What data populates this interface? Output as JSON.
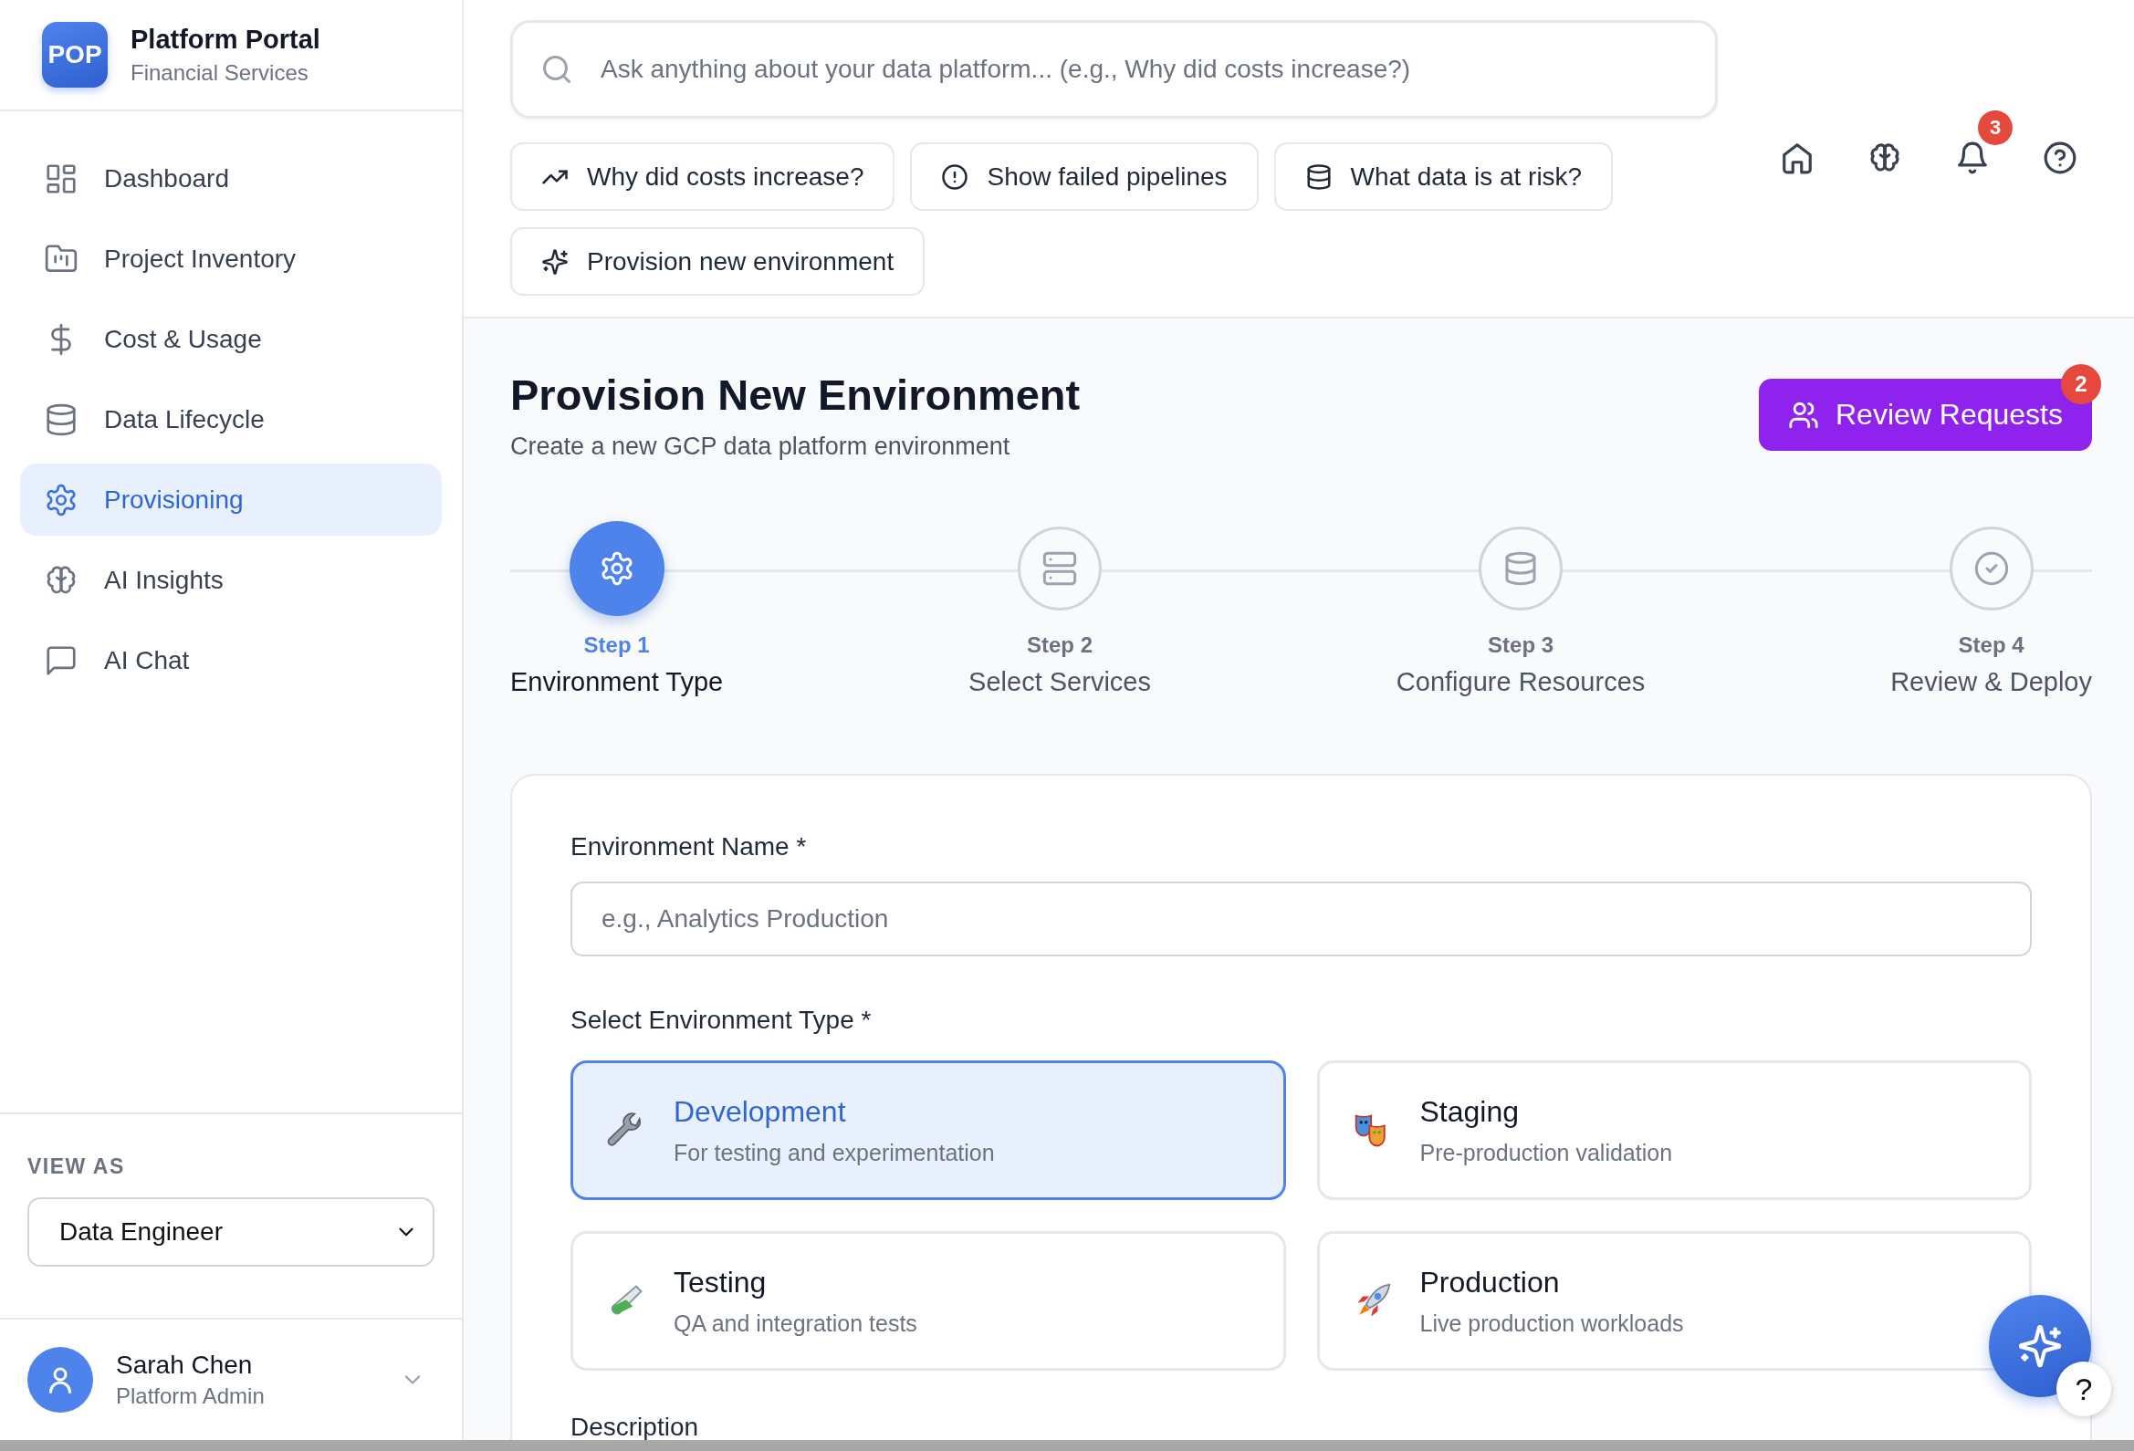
{
  "brand": {
    "logo": "POP",
    "title": "Platform Portal",
    "subtitle": "Financial Services"
  },
  "nav": [
    {
      "label": "Dashboard",
      "kind": "grid",
      "selected": false
    },
    {
      "label": "Project Inventory",
      "kind": "folder",
      "selected": false
    },
    {
      "label": "Cost & Usage",
      "kind": "dollar",
      "selected": false
    },
    {
      "label": "Data Lifecycle",
      "kind": "database",
      "selected": false
    },
    {
      "label": "Provisioning",
      "kind": "gear",
      "selected": true
    },
    {
      "label": "AI Insights",
      "kind": "brain",
      "selected": false
    },
    {
      "label": "AI Chat",
      "kind": "chat",
      "selected": false
    }
  ],
  "view_as": {
    "label": "VIEW AS",
    "value": "Data Engineer"
  },
  "user": {
    "name": "Sarah Chen",
    "role": "Platform Admin"
  },
  "search": {
    "placeholder": "Ask anything about your data platform... (e.g., Why did costs increase?)"
  },
  "suggestions": [
    {
      "label": "Why did costs increase?",
      "kind": "trend"
    },
    {
      "label": "Show failed pipelines",
      "kind": "alert"
    },
    {
      "label": "What data is at risk?",
      "kind": "database"
    },
    {
      "label": "Provision new environment",
      "kind": "sparkles"
    }
  ],
  "toolbar": [
    {
      "kind": "home"
    },
    {
      "kind": "brain"
    },
    {
      "kind": "bell",
      "badge": "3"
    },
    {
      "kind": "help"
    }
  ],
  "page": {
    "title": "Provision New Environment",
    "subtitle": "Create a new GCP data platform environment"
  },
  "review_button": {
    "label": "Review Requests",
    "badge": "2"
  },
  "steps": [
    {
      "step": "Step 1",
      "title": "Environment Type",
      "kind": "gear",
      "selected": true
    },
    {
      "step": "Step 2",
      "title": "Select Services",
      "kind": "server",
      "selected": false
    },
    {
      "step": "Step 3",
      "title": "Configure Resources",
      "kind": "database",
      "selected": false
    },
    {
      "step": "Step 4",
      "title": "Review & Deploy",
      "kind": "check",
      "selected": false
    }
  ],
  "form": {
    "name_label": "Environment Name *",
    "name_placeholder": "e.g., Analytics Production",
    "type_label": "Select Environment Type *",
    "types": [
      {
        "title": "Development",
        "subtitle": "For testing and experimentation",
        "kind": "wrench",
        "selected": true
      },
      {
        "title": "Staging",
        "subtitle": "Pre-production validation",
        "kind": "masks",
        "selected": false
      },
      {
        "title": "Testing",
        "subtitle": "QA and integration tests",
        "kind": "tube",
        "selected": false
      },
      {
        "title": "Production",
        "subtitle": "Live production workloads",
        "kind": "rocket",
        "selected": false
      }
    ],
    "description_label": "Description"
  },
  "help": "?"
}
